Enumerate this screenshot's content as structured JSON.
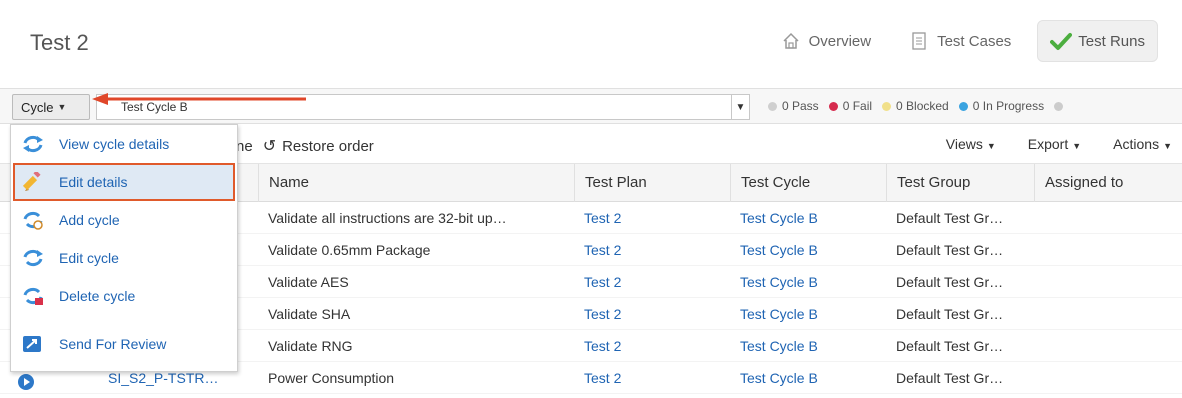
{
  "header": {
    "title": "Test 2",
    "tabs": [
      {
        "label": "Overview",
        "icon": "home-icon",
        "active": false
      },
      {
        "label": "Test Cases",
        "icon": "document-icon",
        "active": false
      },
      {
        "label": "Test Runs",
        "icon": "checkmark-icon",
        "active": true
      }
    ]
  },
  "cycle_bar": {
    "cycle_button_label": "Cycle",
    "cycle_value": "Test Cycle B",
    "status": [
      {
        "label": "0 Pass",
        "color": "#cfcfcf"
      },
      {
        "label": "0 Fail",
        "color": "#d62b4e"
      },
      {
        "label": "0 Blocked",
        "color": "#f1e08a"
      },
      {
        "label": "0 In Progress",
        "color": "#3aa3e0"
      }
    ],
    "extra_dot_color": "#cccccc"
  },
  "toolbar": {
    "partial_text": "ne",
    "restore_label": "Restore order",
    "views_label": "Views",
    "export_label": "Export",
    "actions_label": "Actions"
  },
  "table": {
    "columns": [
      "Name",
      "Test Plan",
      "Test Cycle",
      "Test Group",
      "Assigned to"
    ],
    "rows": [
      {
        "id": "",
        "name": "Validate all instructions are 32-bit up…",
        "plan": "Test 2",
        "cycle": "Test Cycle B",
        "group": "Default Test Gr…",
        "assigned": ""
      },
      {
        "id": "",
        "name": "Validate 0.65mm Package",
        "plan": "Test 2",
        "cycle": "Test Cycle B",
        "group": "Default Test Gr…",
        "assigned": ""
      },
      {
        "id": "",
        "name": "Validate AES",
        "plan": "Test 2",
        "cycle": "Test Cycle B",
        "group": "Default Test Gr…",
        "assigned": ""
      },
      {
        "id": "",
        "name": "Validate SHA",
        "plan": "Test 2",
        "cycle": "Test Cycle B",
        "group": "Default Test Gr…",
        "assigned": ""
      },
      {
        "id": "",
        "name": "Validate RNG",
        "plan": "Test 2",
        "cycle": "Test Cycle B",
        "group": "Default Test Gr…",
        "assigned": ""
      },
      {
        "id": "SI_S2_P-TSTR…",
        "name": "Power Consumption",
        "plan": "Test 2",
        "cycle": "Test Cycle B",
        "group": "Default Test Gr…",
        "assigned": ""
      }
    ]
  },
  "cycle_menu": {
    "items": [
      {
        "label": "View cycle details",
        "icon": "refresh-cycle-icon"
      },
      {
        "label": "Edit details",
        "icon": "pencil-icon",
        "highlighted": true
      },
      {
        "label": "Add cycle",
        "icon": "add-cycle-icon"
      },
      {
        "label": "Edit cycle",
        "icon": "edit-cycle-icon"
      },
      {
        "label": "Delete cycle",
        "icon": "delete-cycle-icon"
      },
      {
        "label": "Send For Review",
        "icon": "send-review-icon"
      }
    ]
  },
  "colors": {
    "link": "#1f64b3",
    "highlight_border": "#e05a2b",
    "arrow": "#e0472a"
  }
}
